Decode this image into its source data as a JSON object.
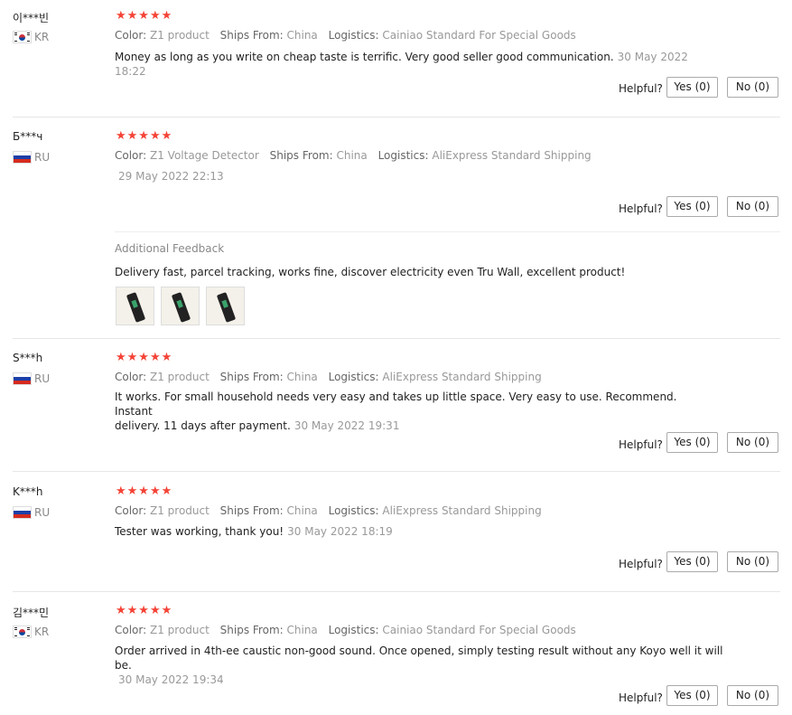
{
  "labels": {
    "color": "Color:",
    "ships_from": "Ships From:",
    "logistics": "Logistics:",
    "helpful": "Helpful?",
    "additional_feedback": "Additional Feedback"
  },
  "stars": "★★★★★",
  "reviews": [
    {
      "user": "이***빈",
      "country": "KR",
      "flag_icon": "kr-flag-icon",
      "rating": 5,
      "color": "Z1 product",
      "ships_from": "China",
      "logistics": "Cainiao Standard For Special Goods",
      "text": "Money as long as you write on cheap taste is terrific. Very good seller good communication.",
      "date": "30 May 2022 18:22",
      "yes": "Yes (0)",
      "no": "No (0)"
    },
    {
      "user": "Б***ч",
      "country": "RU",
      "flag_icon": "ru-flag-icon",
      "rating": 4.5,
      "color": "Z1 Voltage Detector",
      "ships_from": "China",
      "logistics": "AliExpress Standard Shipping",
      "text": "",
      "date": "29 May 2022 22:13",
      "yes": "Yes (0)",
      "no": "No (0)",
      "additional_feedback": "Delivery fast, parcel tracking, works fine, discover electricity even Tru Wall, excellent product!",
      "photos": 3
    },
    {
      "user": "S***h",
      "country": "RU",
      "flag_icon": "ru-flag-icon",
      "rating": 4.5,
      "color": "Z1 product",
      "ships_from": "China",
      "logistics": "AliExpress Standard Shipping",
      "text_line1": "It works. For small household needs very easy and takes up little space. Very easy to use. Recommend. Instant",
      "text_line2": "delivery. 11 days after payment.",
      "date": "30 May 2022 19:31",
      "yes": "Yes (0)",
      "no": "No (0)"
    },
    {
      "user": "K***h",
      "country": "RU",
      "flag_icon": "ru-flag-icon",
      "rating": 5,
      "color": "Z1 product",
      "ships_from": "China",
      "logistics": "AliExpress Standard Shipping",
      "text": "Tester was working, thank you!",
      "date": "30 May 2022 18:19",
      "yes": "Yes (0)",
      "no": "No (0)"
    },
    {
      "user": "김***민",
      "country": "KR",
      "flag_icon": "kr-flag-icon",
      "rating": 5,
      "color": "Z1 product",
      "ships_from": "China",
      "logistics": "Cainiao Standard For Special Goods",
      "text": "Order arrived in 4th-ee caustic non-good sound. Once opened, simply testing result without any Koyo well it will be.",
      "date": "30 May 2022 19:34",
      "yes": "Yes (0)",
      "no": "No (0)"
    }
  ]
}
